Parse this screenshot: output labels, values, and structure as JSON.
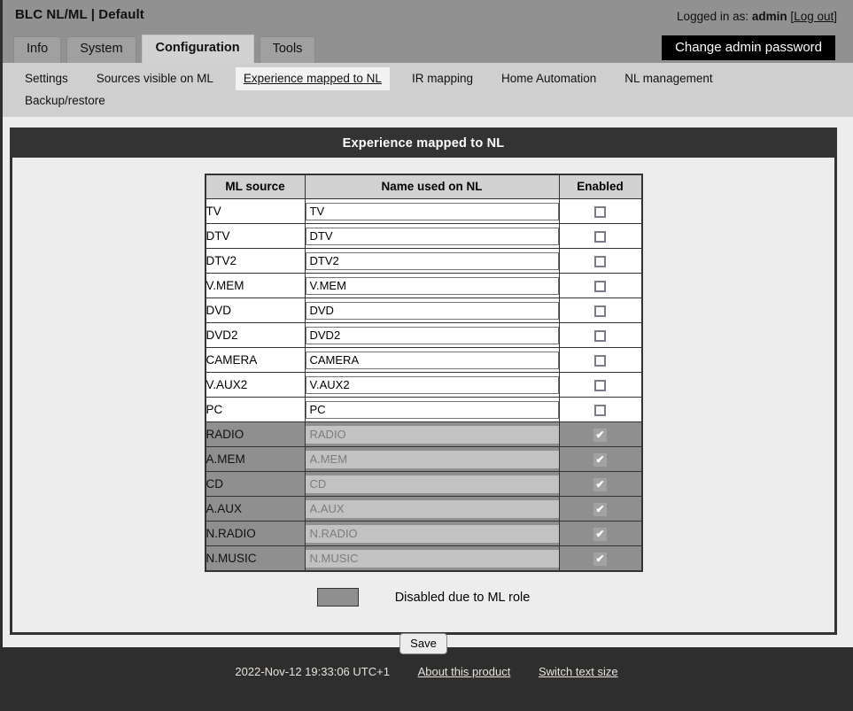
{
  "header": {
    "brand_title": "BLC NL/ML | Default",
    "logged_in_prefix": "Logged in as:",
    "username": "admin",
    "logout_open_bracket": "[",
    "logout_label": "Log out",
    "logout_close_bracket": "]",
    "admin_button": "Change admin password"
  },
  "tabs": [
    {
      "label": "Info",
      "active": false
    },
    {
      "label": "System",
      "active": false
    },
    {
      "label": "Configuration",
      "active": true
    },
    {
      "label": "Tools",
      "active": false
    }
  ],
  "subnav_row1": [
    {
      "label": "Settings",
      "active": false
    },
    {
      "label": "Sources visible on ML",
      "active": false
    },
    {
      "label": "Experience mapped to NL",
      "active": true
    },
    {
      "label": "IR mapping",
      "active": false
    },
    {
      "label": "Home Automation",
      "active": false
    },
    {
      "label": "NL management",
      "active": false
    }
  ],
  "subnav_row2": [
    {
      "label": "Backup/restore",
      "active": false
    }
  ],
  "panel": {
    "title": "Experience mapped to NL"
  },
  "table": {
    "columns": [
      "ML source",
      "Name used on NL",
      "Enabled"
    ],
    "rows": [
      {
        "source": "TV",
        "name": "TV",
        "enabled": false,
        "disabled": false
      },
      {
        "source": "DTV",
        "name": "DTV",
        "enabled": false,
        "disabled": false
      },
      {
        "source": "DTV2",
        "name": "DTV2",
        "enabled": false,
        "disabled": false
      },
      {
        "source": "V.MEM",
        "name": "V.MEM",
        "enabled": false,
        "disabled": false
      },
      {
        "source": "DVD",
        "name": "DVD",
        "enabled": false,
        "disabled": false
      },
      {
        "source": "DVD2",
        "name": "DVD2",
        "enabled": false,
        "disabled": false
      },
      {
        "source": "CAMERA",
        "name": "CAMERA",
        "enabled": false,
        "disabled": false
      },
      {
        "source": "V.AUX2",
        "name": "V.AUX2",
        "enabled": false,
        "disabled": false
      },
      {
        "source": "PC",
        "name": "PC",
        "enabled": false,
        "disabled": false
      },
      {
        "source": "RADIO",
        "name": "RADIO",
        "enabled": true,
        "disabled": true
      },
      {
        "source": "A.MEM",
        "name": "A.MEM",
        "enabled": true,
        "disabled": true
      },
      {
        "source": "CD",
        "name": "CD",
        "enabled": true,
        "disabled": true
      },
      {
        "source": "A.AUX",
        "name": "A.AUX",
        "enabled": true,
        "disabled": true
      },
      {
        "source": "N.RADIO",
        "name": "N.RADIO",
        "enabled": true,
        "disabled": true
      },
      {
        "source": "N.MUSIC",
        "name": "N.MUSIC",
        "enabled": true,
        "disabled": true
      }
    ]
  },
  "legend": {
    "label": "Disabled due to ML role",
    "swatch_color": "#8f8f8f"
  },
  "actions": {
    "save_label": "Save"
  },
  "footer": {
    "timestamp": "2022-Nov-12 19:33:06 UTC+1",
    "about_link": "About this product",
    "textsize_link": "Switch text size"
  },
  "icons": {
    "checkmark": "✔"
  },
  "colors": {
    "page_background": "#2e2e2e",
    "header_background": "#919191",
    "subnav_background": "#cfcfcf",
    "panel_header": "#333333",
    "content_background": "#ededed",
    "disabled_row": "#8f8f8f",
    "admin_button": "#000000"
  }
}
